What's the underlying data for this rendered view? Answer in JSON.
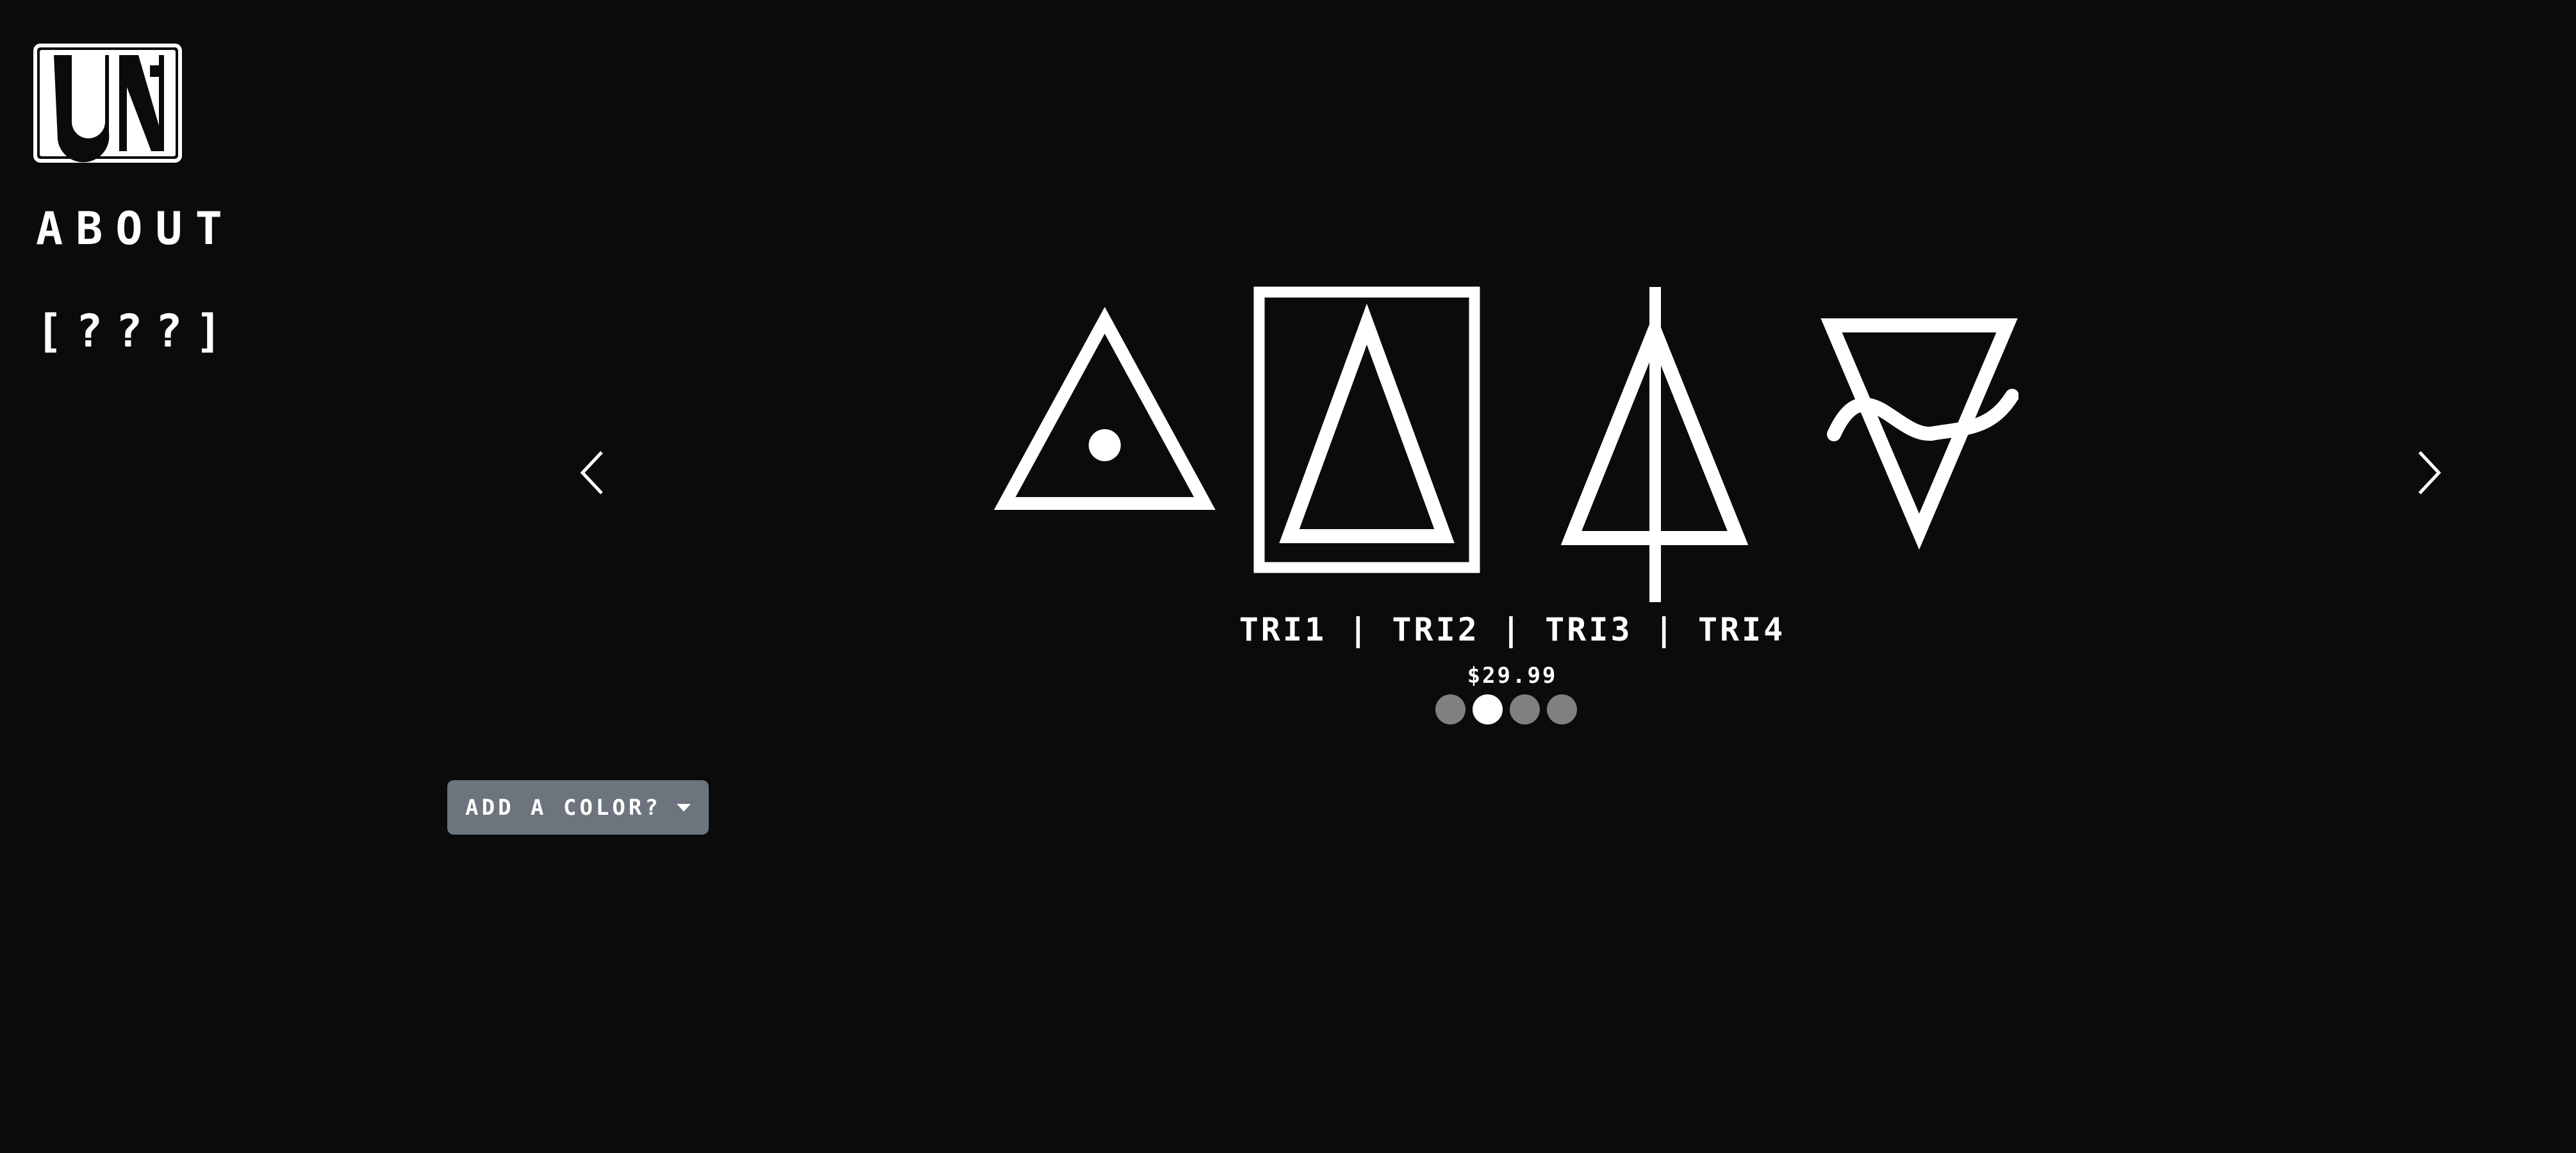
{
  "brand": {
    "logo_icon": "uni-logo"
  },
  "nav": {
    "items": [
      {
        "label": "ABOUT"
      },
      {
        "label": "[???]"
      }
    ]
  },
  "carousel": {
    "prev_icon": "chevron-left-icon",
    "next_icon": "chevron-right-icon",
    "symbols": [
      "triangle-dot-icon",
      "framed-triangle-icon",
      "pierced-triangle-icon",
      "inverted-wave-triangle-icon"
    ],
    "title": "TRI1 | TRI2 | TRI3 | TRI4",
    "price": "$29.99",
    "color_dots": [
      {
        "color": "#808080",
        "active": false
      },
      {
        "color": "#ffffff",
        "active": true
      },
      {
        "color": "#808080",
        "active": false
      },
      {
        "color": "#808080",
        "active": false
      }
    ]
  },
  "color_select": {
    "label": "ADD A COLOR?",
    "icon": "caret-down-icon",
    "color": "#6c757d"
  },
  "theme": {
    "background": "#0b0b0b",
    "foreground": "#ffffff"
  }
}
